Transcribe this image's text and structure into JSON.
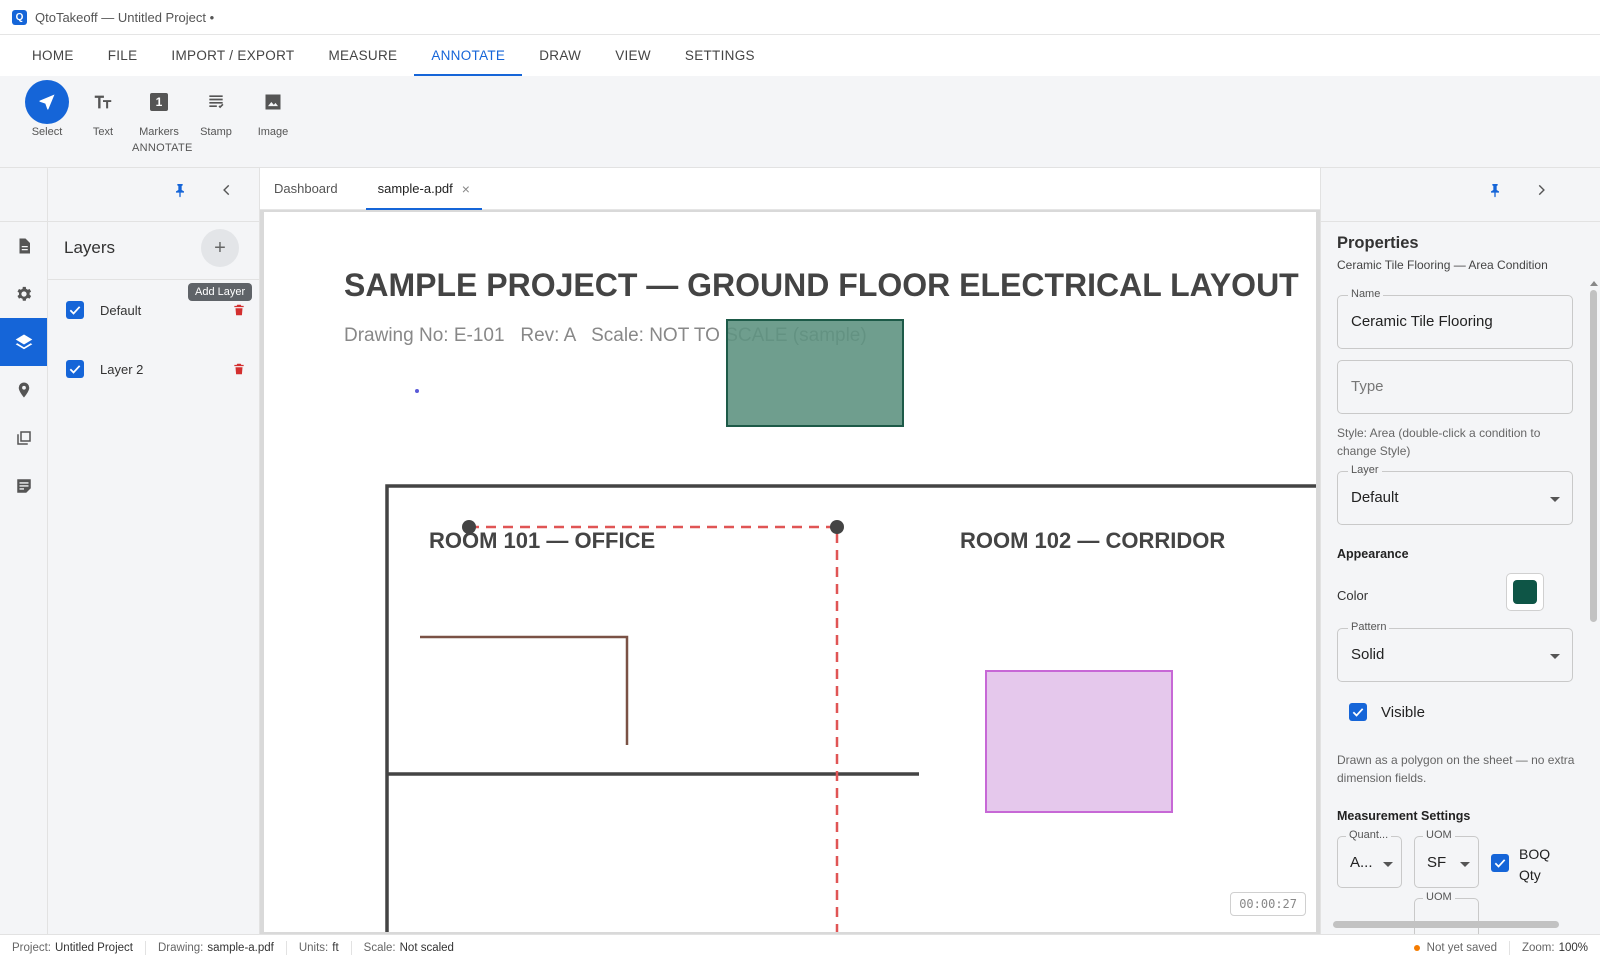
{
  "window": {
    "logo_letter": "Q",
    "title": "QtoTakeoff — Untitled Project •"
  },
  "menu": {
    "tabs": [
      "HOME",
      "FILE",
      "IMPORT / EXPORT",
      "MEASURE",
      "ANNOTATE",
      "DRAW",
      "VIEW",
      "SETTINGS"
    ],
    "active": "ANNOTATE"
  },
  "ribbon": {
    "group_label": "ANNOTATE",
    "tools": [
      {
        "label": "Select",
        "icon": "navigation-arrow-icon",
        "active": true
      },
      {
        "label": "Text",
        "icon": "text-size-icon"
      },
      {
        "label": "Markers",
        "icon": "marker-number-icon",
        "marker_glyph": "1"
      },
      {
        "label": "Stamp",
        "icon": "stamp-list-icon"
      },
      {
        "label": "Image",
        "icon": "image-icon"
      }
    ]
  },
  "left_rail": {
    "items": [
      "document-icon",
      "settings-gear-icon",
      "layers-icon",
      "location-pin-icon",
      "pages-icon",
      "notes-icon"
    ],
    "active": "layers-icon"
  },
  "layers_panel": {
    "title": "Layers",
    "add_tooltip": "Add Layer",
    "add_glyph": "+",
    "layers": [
      {
        "name": "Default",
        "visible": true
      },
      {
        "name": "Layer 2",
        "visible": true
      }
    ]
  },
  "doc_tabs": {
    "tabs": [
      {
        "label": "Dashboard"
      },
      {
        "label": "sample-a.pdf",
        "active": true,
        "closable": true
      }
    ],
    "close_glyph": "×"
  },
  "drawing": {
    "title": "SAMPLE PROJECT — GROUND FLOOR ELECTRICAL LAYOUT",
    "subtitle": "Drawing No: E-101   Rev: A   Scale: NOT TO SCALE (sample)",
    "room_101": "ROOM 101 — OFFICE",
    "room_102": "ROOM 102 — CORRIDOR",
    "timer": "00:00:27",
    "colors": {
      "green_rect": "#5f9382",
      "pink_rect": "#e5c8ec",
      "measure_line": "#e05555"
    }
  },
  "properties": {
    "title": "Properties",
    "subtitle": "Ceramic Tile Flooring — Area Condition",
    "name_label": "Name",
    "name_value": "Ceramic Tile Flooring",
    "type_placeholder": "Type",
    "style_hint": "Style: Area (double-click a condition to change Style)",
    "layer_label": "Layer",
    "layer_value": "Default",
    "appearance_title": "Appearance",
    "color_label": "Color",
    "color_value": "#0e5546",
    "pattern_label": "Pattern",
    "pattern_value": "Solid",
    "visible_label": "Visible",
    "visible_checked": true,
    "polygon_hint": "Drawn as a polygon on the sheet — no extra dimension fields.",
    "measurement_title": "Measurement Settings",
    "quantity_label": "Quant...",
    "quantity_value": "A...",
    "uom_label": "UOM",
    "uom_value": "SF",
    "uom2_label": "UOM",
    "boq_label": "BOQ Qty",
    "boq_checked": true
  },
  "status": {
    "project_label": "Project:",
    "project_value": "Untitled Project",
    "drawing_label": "Drawing:",
    "drawing_value": "sample-a.pdf",
    "units_label": "Units:",
    "units_value": "ft",
    "scale_label": "Scale:",
    "scale_value": "Not scaled",
    "save_state": "Not yet saved",
    "zoom_label": "Zoom:",
    "zoom_value": "100%"
  }
}
